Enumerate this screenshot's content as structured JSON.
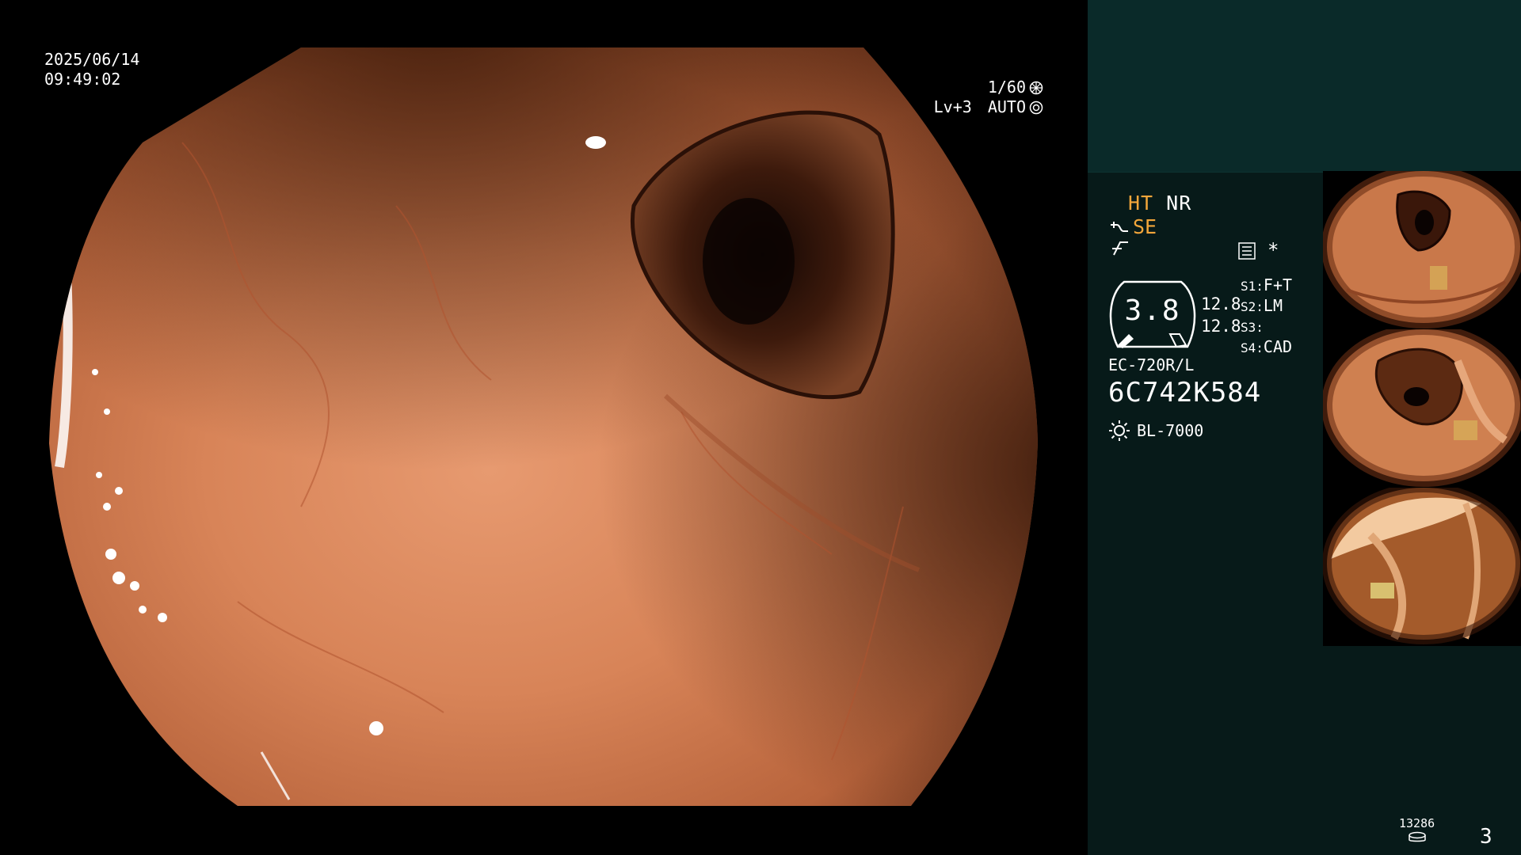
{
  "overlay": {
    "date": "2025/06/14",
    "time": "09:49:02",
    "shutter_speed": "1/60",
    "shutter_icon": "aperture-icon",
    "brightness_level": "Lv+3",
    "iris_mode": "AUTO",
    "iris_icon": "iris-icon"
  },
  "panel": {
    "mode_ht": "HT",
    "mode_nr": "NR",
    "mode_se": "SE",
    "se_icon": "hose-icon",
    "scope_icon": "scope-angle-icon",
    "menu_icon": "settings-list-icon",
    "asterisk": "*",
    "gauge_value": "3.8",
    "zoom_values": [
      "12.8",
      "12.8"
    ],
    "switches": [
      {
        "label": "S1:",
        "value": "F+T"
      },
      {
        "label": "S2:",
        "value": "LM"
      },
      {
        "label": "S3:",
        "value": ""
      },
      {
        "label": "S4:",
        "value": "CAD"
      }
    ],
    "scope_model": "EC-720R/L",
    "scope_serial": "6C742K584",
    "light_source": "BL-7000",
    "light_icon": "sun-icon",
    "storage_count": "13286",
    "storage_icon": "disk-icon",
    "page_number": "3"
  },
  "colors": {
    "amber": "#f3a63a",
    "panel_bg": "#071a19",
    "panel_top_bg": "#0a2a29",
    "mucosa": "#d17f55"
  },
  "thumbnails": [
    {
      "icon": "endoscopy-thumbnail-1"
    },
    {
      "icon": "endoscopy-thumbnail-2"
    },
    {
      "icon": "endoscopy-thumbnail-3"
    }
  ]
}
